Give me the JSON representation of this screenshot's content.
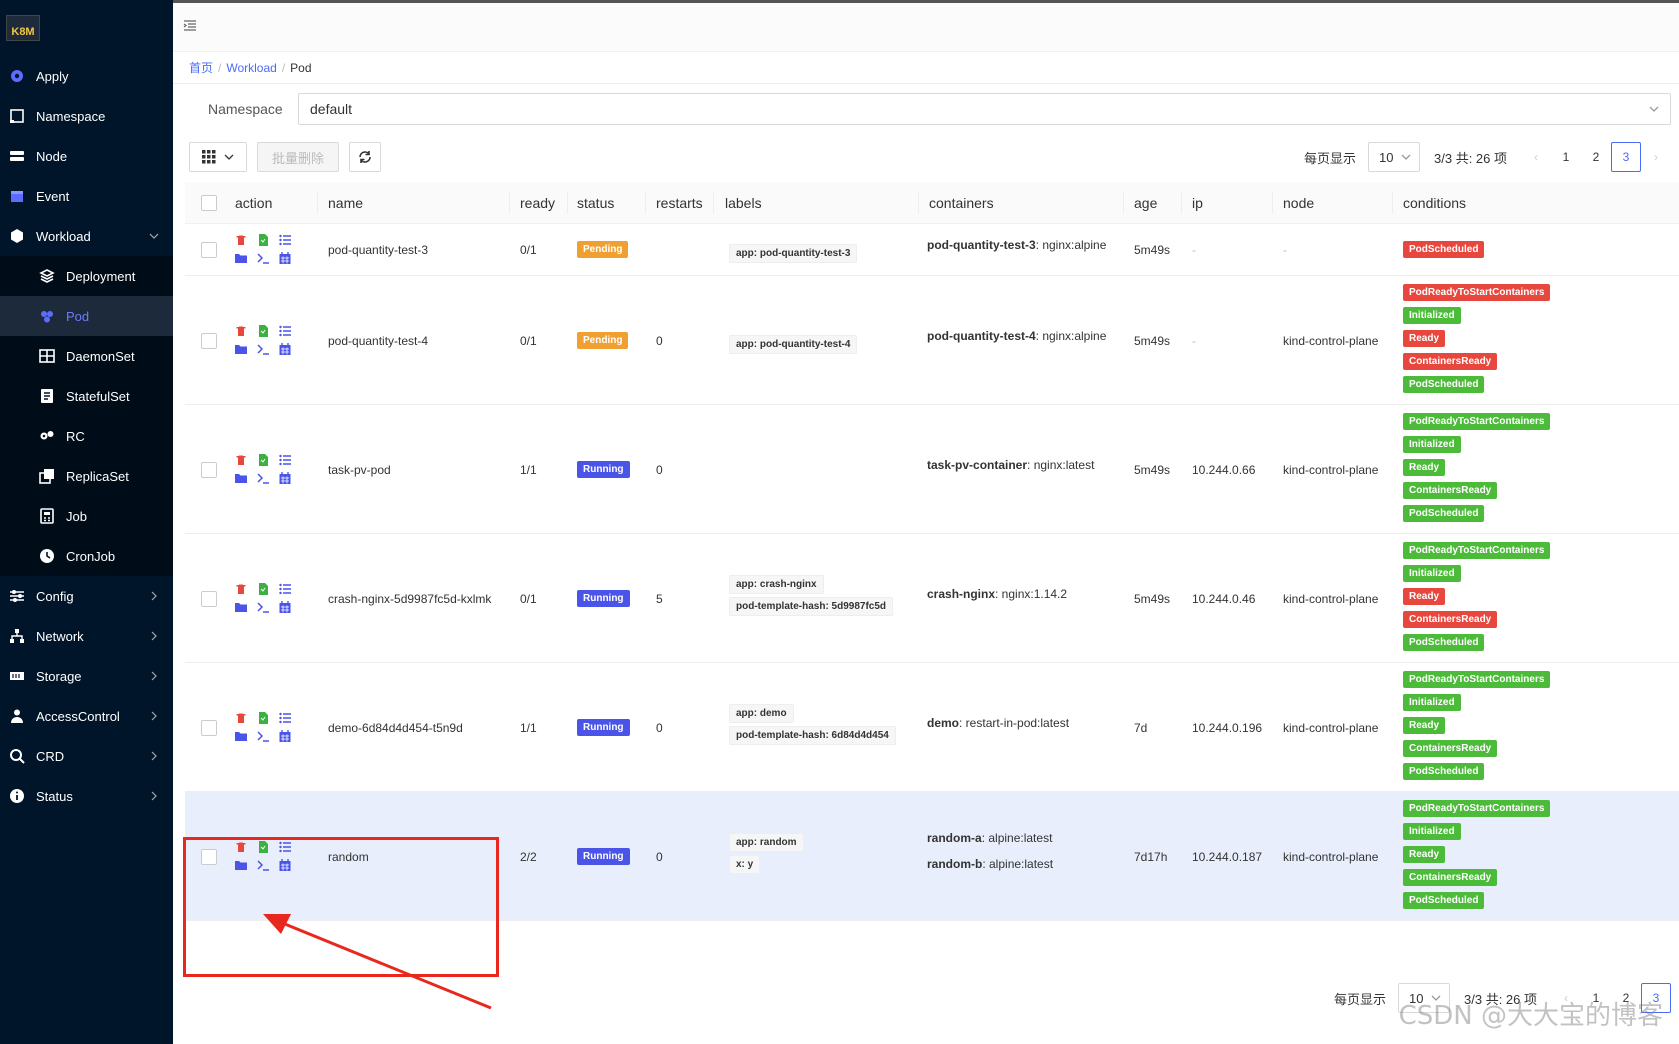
{
  "sidebar": {
    "logo": "K8M",
    "items": [
      {
        "label": "Apply",
        "icon": "apply-icon"
      },
      {
        "label": "Namespace",
        "icon": "namespace-icon"
      },
      {
        "label": "Node",
        "icon": "node-icon"
      },
      {
        "label": "Event",
        "icon": "event-icon"
      },
      {
        "label": "Workload",
        "icon": "workload-icon",
        "expanded": true
      },
      {
        "label": "Deployment",
        "icon": "deployment-icon",
        "sub": true
      },
      {
        "label": "Pod",
        "icon": "pod-icon",
        "sub": true,
        "active": true
      },
      {
        "label": "DaemonSet",
        "icon": "daemonset-icon",
        "sub": true
      },
      {
        "label": "StatefulSet",
        "icon": "statefulset-icon",
        "sub": true
      },
      {
        "label": "RC",
        "icon": "rc-icon",
        "sub": true
      },
      {
        "label": "ReplicaSet",
        "icon": "replicaset-icon",
        "sub": true
      },
      {
        "label": "Job",
        "icon": "job-icon",
        "sub": true
      },
      {
        "label": "CronJob",
        "icon": "cronjob-icon",
        "sub": true
      },
      {
        "label": "Config",
        "icon": "config-icon"
      },
      {
        "label": "Network",
        "icon": "network-icon"
      },
      {
        "label": "Storage",
        "icon": "storage-icon"
      },
      {
        "label": "AccessControl",
        "icon": "access-control-icon"
      },
      {
        "label": "CRD",
        "icon": "crd-icon"
      },
      {
        "label": "Status",
        "icon": "status-icon"
      }
    ]
  },
  "breadcrumb": {
    "home": "首页",
    "workload": "Workload",
    "current": "Pod"
  },
  "namespace": {
    "label": "Namespace",
    "value": "default"
  },
  "toolbar": {
    "batch_delete": "批量删除"
  },
  "pager": {
    "per_page_label": "每页显示",
    "page_size": "10",
    "total": "3/3 共: 26 项",
    "pages": [
      "1",
      "2",
      "3"
    ],
    "current": "3"
  },
  "table": {
    "columns": [
      "action",
      "name",
      "ready",
      "status",
      "restarts",
      "labels",
      "containers",
      "age",
      "ip",
      "node",
      "conditions"
    ],
    "rows": [
      {
        "name": "pod-quantity-test-3",
        "ready": "0/1",
        "status": "Pending",
        "restarts": "",
        "labels": [
          "app: pod-quantity-test-3"
        ],
        "containers": [
          {
            "name": "pod-quantity-test-3",
            "image": ": nginx:alpine"
          }
        ],
        "age": "5m49s",
        "ip": "-",
        "node": "-",
        "conditions": [
          {
            "t": "PodScheduled",
            "c": "red"
          }
        ]
      },
      {
        "name": "pod-quantity-test-4",
        "ready": "0/1",
        "status": "Pending",
        "restarts": "0",
        "labels": [
          "app: pod-quantity-test-4"
        ],
        "containers": [
          {
            "name": "pod-quantity-test-4",
            "image": ": nginx:alpine"
          }
        ],
        "age": "5m49s",
        "ip": "-",
        "node": "kind-control-plane",
        "conditions": [
          {
            "t": "PodReadyToStartContainers",
            "c": "red"
          },
          {
            "t": "Initialized",
            "c": "green"
          },
          {
            "t": "Ready",
            "c": "red"
          },
          {
            "t": "ContainersReady",
            "c": "red"
          },
          {
            "t": "PodScheduled",
            "c": "green"
          }
        ]
      },
      {
        "name": "task-pv-pod",
        "ready": "1/1",
        "status": "Running",
        "restarts": "0",
        "labels": [],
        "containers": [
          {
            "name": "task-pv-container",
            "image": ": nginx:latest"
          }
        ],
        "age": "5m49s",
        "ip": "10.244.0.66",
        "node": "kind-control-plane",
        "conditions": [
          {
            "t": "PodReadyToStartContainers",
            "c": "green"
          },
          {
            "t": "Initialized",
            "c": "green"
          },
          {
            "t": "Ready",
            "c": "green"
          },
          {
            "t": "ContainersReady",
            "c": "green"
          },
          {
            "t": "PodScheduled",
            "c": "green"
          }
        ]
      },
      {
        "name": "crash-nginx-5d9987fc5d-kxlmk",
        "ready": "0/1",
        "status": "Running",
        "restarts": "5",
        "labels": [
          "app: crash-nginx",
          "pod-template-hash: 5d9987fc5d"
        ],
        "containers": [
          {
            "name": "crash-nginx",
            "image": ": nginx:1.14.2"
          }
        ],
        "age": "5m49s",
        "ip": "10.244.0.46",
        "node": "kind-control-plane",
        "conditions": [
          {
            "t": "PodReadyToStartContainers",
            "c": "green"
          },
          {
            "t": "Initialized",
            "c": "green"
          },
          {
            "t": "Ready",
            "c": "red"
          },
          {
            "t": "ContainersReady",
            "c": "red"
          },
          {
            "t": "PodScheduled",
            "c": "green"
          }
        ]
      },
      {
        "name": "demo-6d84d4d454-t5n9d",
        "ready": "1/1",
        "status": "Running",
        "restarts": "0",
        "labels": [
          "app: demo",
          "pod-template-hash: 6d84d4d454"
        ],
        "containers": [
          {
            "name": "demo",
            "image": ": restart-in-pod:latest"
          }
        ],
        "age": "7d",
        "ip": "10.244.0.196",
        "node": "kind-control-plane",
        "conditions": [
          {
            "t": "PodReadyToStartContainers",
            "c": "green"
          },
          {
            "t": "Initialized",
            "c": "green"
          },
          {
            "t": "Ready",
            "c": "green"
          },
          {
            "t": "ContainersReady",
            "c": "green"
          },
          {
            "t": "PodScheduled",
            "c": "green"
          }
        ]
      },
      {
        "name": "random",
        "ready": "2/2",
        "status": "Running",
        "restarts": "0",
        "labels": [
          "app: random",
          "x: y"
        ],
        "containers": [
          {
            "name": "random-a",
            "image": ": alpine:latest"
          },
          {
            "name": "random-b",
            "image": ": alpine:latest"
          }
        ],
        "age": "7d17h",
        "ip": "10.244.0.187",
        "node": "kind-control-plane",
        "conditions": [
          {
            "t": "PodReadyToStartContainers",
            "c": "green"
          },
          {
            "t": "Initialized",
            "c": "green"
          },
          {
            "t": "Ready",
            "c": "green"
          },
          {
            "t": "ContainersReady",
            "c": "green"
          },
          {
            "t": "PodScheduled",
            "c": "green"
          }
        ],
        "selected": true
      }
    ]
  },
  "watermark": "CSDN @大大宝的博客",
  "colors": {
    "sidebar_bg": "#001529",
    "accent": "#4a6cf7",
    "pending": "#f0a030",
    "running": "#4a54e8",
    "cond_red": "#e8473d",
    "cond_green": "#4cbb3a",
    "highlight_box": "#e8281e"
  }
}
